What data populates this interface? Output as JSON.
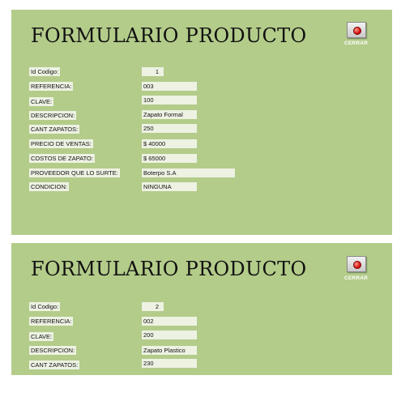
{
  "forms": [
    {
      "title": "FORMULARIO PRODUCTO",
      "close_label": "CERRAR",
      "fields": [
        {
          "label": "Id Codigo:",
          "value": "1"
        },
        {
          "label": "REFERENCIA:",
          "value": "003"
        },
        {
          "label": "CLAVE:",
          "value": "100"
        },
        {
          "label": "DESCRIPCION:",
          "value": "Zapato Formal"
        },
        {
          "label": "CANT ZAPATOS:",
          "value": "250"
        },
        {
          "label": "PRECIO DE VENTAS:",
          "value": "$ 40000"
        },
        {
          "label": "COSTOS DE ZAPATO:",
          "value": "$ 65000"
        },
        {
          "label": "PROVEEDOR  QUE LO SURTE:",
          "value": "Boterpo S.A"
        },
        {
          "label": "CONDICION:",
          "value": "NINGUNA"
        }
      ]
    },
    {
      "title": "FORMULARIO PRODUCTO",
      "close_label": "CERRAR",
      "fields": [
        {
          "label": "Id Codigo:",
          "value": "2"
        },
        {
          "label": "REFERENCIA:",
          "value": "002"
        },
        {
          "label": "CLAVE:",
          "value": "200"
        },
        {
          "label": "DESCRIPCION:",
          "value": "Zapato Plastico"
        },
        {
          "label": "CANT ZAPATOS:",
          "value": "230"
        }
      ]
    }
  ],
  "colors": {
    "panel_background": "#b3cc8a",
    "field_background": "#edf2e3",
    "close_button_dot": "#d40000"
  },
  "icons": {
    "close": "red-dot-button-icon"
  }
}
